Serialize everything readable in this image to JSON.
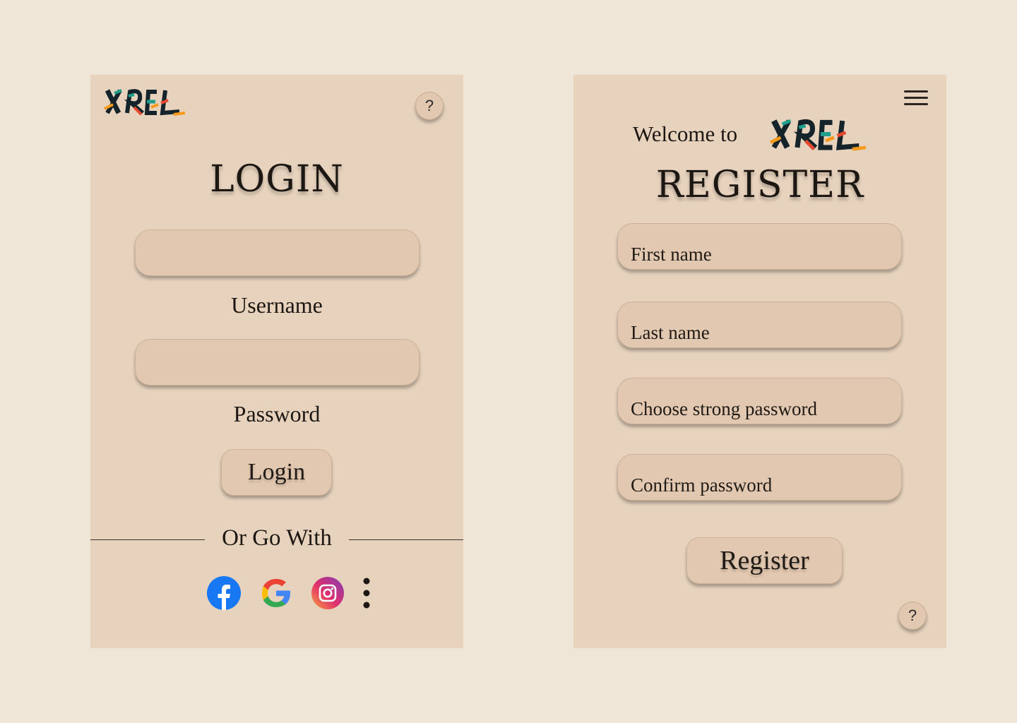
{
  "brand": {
    "logo_text": "XREL"
  },
  "login": {
    "help_label": "?",
    "title": "LOGIN",
    "username_label": "Username",
    "username_value": "",
    "password_label": "Password",
    "password_value": "",
    "login_button": "Login",
    "divider_text": "Or Go With",
    "social": [
      "facebook-icon",
      "google-icon",
      "instagram-icon",
      "more-options-icon"
    ]
  },
  "register": {
    "welcome_text": "Welcome to",
    "title": "REGISTER",
    "first_name_placeholder": "First name",
    "last_name_placeholder": "Last name",
    "password_placeholder": "Choose strong password",
    "confirm_password_placeholder": "Confirm password",
    "register_button": "Register",
    "help_label": "?"
  },
  "colors": {
    "page_bg": "#f0e6d8",
    "card_bg": "#e6d2bd",
    "field_bg": "#e2c8b0",
    "facebook": "#1877f2",
    "logo_dark": "#15232a",
    "logo_orange": "#f59a1b",
    "logo_teal": "#1f9e8c",
    "logo_red": "#e64a2e"
  }
}
